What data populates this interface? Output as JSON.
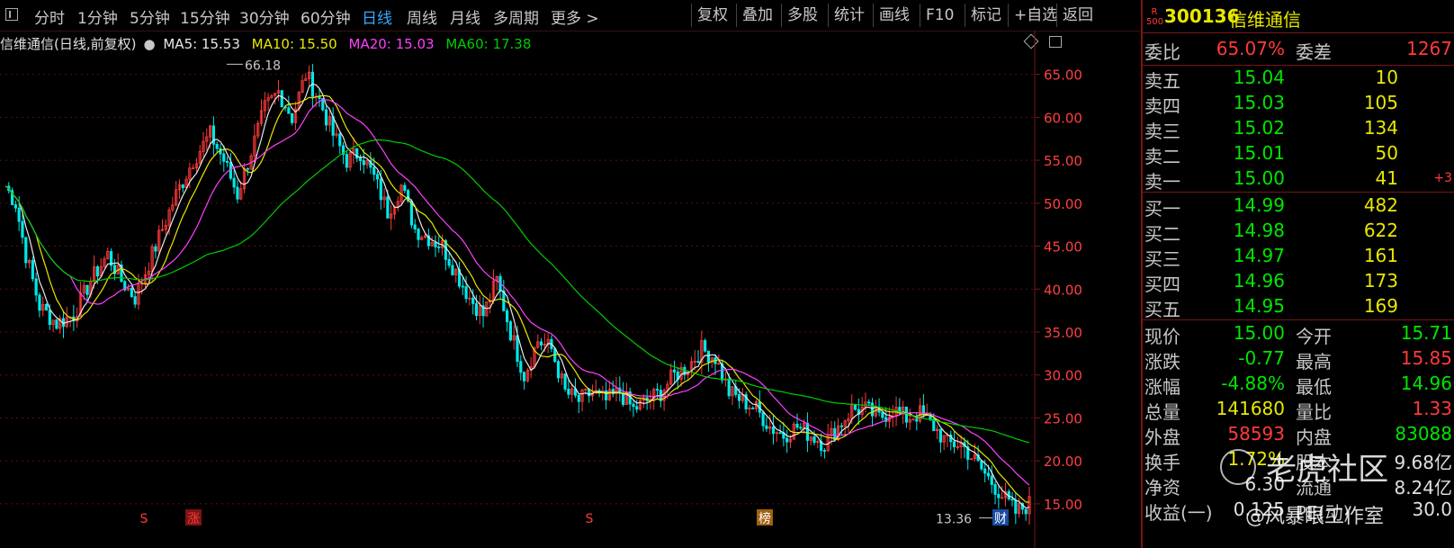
{
  "toolbar": {
    "periods": [
      "分时",
      "1分钟",
      "5分钟",
      "15分钟",
      "30分钟",
      "60分钟",
      "日线",
      "周线",
      "月线",
      "多周期",
      "更多 >"
    ],
    "active_period": "日线",
    "tools": [
      "复权",
      "叠加",
      "多股",
      "统计",
      "画线",
      "F10",
      "标记",
      "+自选",
      "返回"
    ]
  },
  "legend": {
    "title": "信维通信(日线,前复权)",
    "ma5": "MA5: 15.53",
    "ma10": "MA10: 15.50",
    "ma20": "MA20: 15.03",
    "ma60": "MA60: 17.38"
  },
  "colors": {
    "ma5": "#e8e8e8",
    "ma10": "#e8e800",
    "ma20": "#ff40ff",
    "ma60": "#00cc00",
    "up": "#ff3a3a",
    "down": "#00e8e8",
    "grid": "#5a1010"
  },
  "chart_data": {
    "type": "candlestick",
    "ylim": [
      13,
      68
    ],
    "y_ticks": [
      "65.00",
      "60.00",
      "55.00",
      "50.00",
      "45.00",
      "40.00",
      "35.00",
      "30.00",
      "25.00",
      "20.00",
      "15.00"
    ],
    "price_path": [
      [
        0,
        52
      ],
      [
        3,
        50
      ],
      [
        6,
        44
      ],
      [
        10,
        38
      ],
      [
        15,
        36
      ],
      [
        20,
        37
      ],
      [
        25,
        41
      ],
      [
        30,
        44
      ],
      [
        34,
        41
      ],
      [
        38,
        39
      ],
      [
        42,
        43
      ],
      [
        46,
        47
      ],
      [
        50,
        51
      ],
      [
        55,
        55
      ],
      [
        60,
        58
      ],
      [
        64,
        55
      ],
      [
        68,
        51
      ],
      [
        72,
        56
      ],
      [
        76,
        61
      ],
      [
        80,
        63
      ],
      [
        84,
        60
      ],
      [
        88,
        65
      ],
      [
        92,
        62
      ],
      [
        96,
        58
      ],
      [
        100,
        55
      ],
      [
        104,
        56
      ],
      [
        108,
        53
      ],
      [
        112,
        49
      ],
      [
        116,
        52
      ],
      [
        120,
        47
      ],
      [
        124,
        46
      ],
      [
        128,
        45
      ],
      [
        132,
        42
      ],
      [
        136,
        39
      ],
      [
        140,
        37
      ],
      [
        144,
        41
      ],
      [
        148,
        35
      ],
      [
        152,
        30
      ],
      [
        156,
        34
      ],
      [
        160,
        33
      ],
      [
        164,
        28
      ],
      [
        168,
        27
      ],
      [
        172,
        28
      ],
      [
        176,
        27
      ],
      [
        180,
        28
      ],
      [
        184,
        26
      ],
      [
        188,
        27
      ],
      [
        192,
        28
      ],
      [
        196,
        30
      ],
      [
        200,
        31
      ],
      [
        204,
        33
      ],
      [
        208,
        32
      ],
      [
        212,
        28
      ],
      [
        216,
        27
      ],
      [
        220,
        26
      ],
      [
        224,
        24
      ],
      [
        228,
        23
      ],
      [
        232,
        24
      ],
      [
        236,
        23
      ],
      [
        240,
        22
      ],
      [
        244,
        24
      ],
      [
        248,
        26
      ],
      [
        252,
        26
      ],
      [
        256,
        25
      ],
      [
        260,
        26
      ],
      [
        264,
        25
      ],
      [
        268,
        25.5
      ],
      [
        272,
        24
      ],
      [
        276,
        22
      ],
      [
        280,
        22
      ],
      [
        284,
        20
      ],
      [
        288,
        18
      ],
      [
        292,
        16
      ],
      [
        296,
        14
      ],
      [
        300,
        15
      ]
    ],
    "max_label": "66.18",
    "min_label": "13.36",
    "markers": [
      "S",
      "涨",
      "S",
      "榜",
      "财"
    ]
  },
  "quote": {
    "board": "R 500",
    "code": "300136",
    "name": "信维通信",
    "weibi_label": "委比",
    "weibi": "65.07%",
    "weicha_label": "委差",
    "weicha": "1267",
    "asks": [
      {
        "label": "卖五",
        "price": "15.04",
        "vol": "10",
        "extra": ""
      },
      {
        "label": "卖四",
        "price": "15.03",
        "vol": "105",
        "extra": ""
      },
      {
        "label": "卖三",
        "price": "15.02",
        "vol": "134",
        "extra": ""
      },
      {
        "label": "卖二",
        "price": "15.01",
        "vol": "50",
        "extra": ""
      },
      {
        "label": "卖一",
        "price": "15.00",
        "vol": "41",
        "extra": "+3"
      }
    ],
    "bids": [
      {
        "label": "买一",
        "price": "14.99",
        "vol": "482"
      },
      {
        "label": "买二",
        "price": "14.98",
        "vol": "622"
      },
      {
        "label": "买三",
        "price": "14.97",
        "vol": "161"
      },
      {
        "label": "买四",
        "price": "14.96",
        "vol": "173"
      },
      {
        "label": "买五",
        "price": "14.95",
        "vol": "169"
      }
    ],
    "stats": [
      {
        "l1": "现价",
        "v1": "15.00",
        "c1": "green",
        "l2": "今开",
        "v2": "15.71",
        "c2": "green"
      },
      {
        "l1": "涨跌",
        "v1": "-0.77",
        "c1": "green",
        "l2": "最高",
        "v2": "15.85",
        "c2": "red"
      },
      {
        "l1": "涨幅",
        "v1": "-4.88%",
        "c1": "green",
        "l2": "最低",
        "v2": "14.96",
        "c2": "green"
      },
      {
        "l1": "总量",
        "v1": "141680",
        "c1": "yellow",
        "l2": "量比",
        "v2": "1.33",
        "c2": "red"
      },
      {
        "l1": "外盘",
        "v1": "58593",
        "c1": "red",
        "l2": "内盘",
        "v2": "83088",
        "c2": "green"
      },
      {
        "l1": "换手",
        "v1": "1.72%",
        "c1": "yellow",
        "l2": "股本",
        "v2": "9.68亿",
        "c2": "white"
      },
      {
        "l1": "净资",
        "v1": "6.30",
        "c1": "white",
        "l2": "流通",
        "v2": "8.24亿",
        "c2": "white"
      },
      {
        "l1": "收益(一)",
        "v1": "0.125",
        "c1": "white",
        "l2": "PE(动)",
        "v2": "30.0",
        "c2": "white"
      }
    ]
  },
  "watermark": {
    "main": "老虎社区",
    "sub": "@风暴眼工作室"
  }
}
